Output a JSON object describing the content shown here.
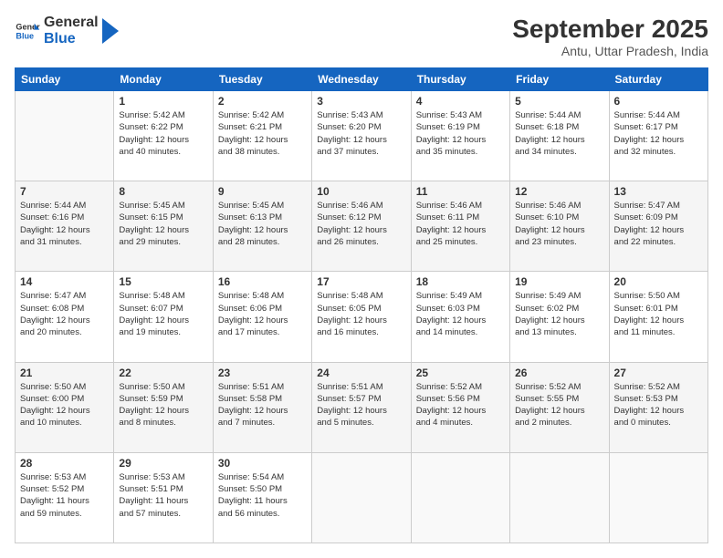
{
  "header": {
    "logo_general": "General",
    "logo_blue": "Blue",
    "month_title": "September 2025",
    "subtitle": "Antu, Uttar Pradesh, India"
  },
  "days_of_week": [
    "Sunday",
    "Monday",
    "Tuesday",
    "Wednesday",
    "Thursday",
    "Friday",
    "Saturday"
  ],
  "weeks": [
    [
      {
        "day": "",
        "info": ""
      },
      {
        "day": "1",
        "info": "Sunrise: 5:42 AM\nSunset: 6:22 PM\nDaylight: 12 hours\nand 40 minutes."
      },
      {
        "day": "2",
        "info": "Sunrise: 5:42 AM\nSunset: 6:21 PM\nDaylight: 12 hours\nand 38 minutes."
      },
      {
        "day": "3",
        "info": "Sunrise: 5:43 AM\nSunset: 6:20 PM\nDaylight: 12 hours\nand 37 minutes."
      },
      {
        "day": "4",
        "info": "Sunrise: 5:43 AM\nSunset: 6:19 PM\nDaylight: 12 hours\nand 35 minutes."
      },
      {
        "day": "5",
        "info": "Sunrise: 5:44 AM\nSunset: 6:18 PM\nDaylight: 12 hours\nand 34 minutes."
      },
      {
        "day": "6",
        "info": "Sunrise: 5:44 AM\nSunset: 6:17 PM\nDaylight: 12 hours\nand 32 minutes."
      }
    ],
    [
      {
        "day": "7",
        "info": "Sunrise: 5:44 AM\nSunset: 6:16 PM\nDaylight: 12 hours\nand 31 minutes."
      },
      {
        "day": "8",
        "info": "Sunrise: 5:45 AM\nSunset: 6:15 PM\nDaylight: 12 hours\nand 29 minutes."
      },
      {
        "day": "9",
        "info": "Sunrise: 5:45 AM\nSunset: 6:13 PM\nDaylight: 12 hours\nand 28 minutes."
      },
      {
        "day": "10",
        "info": "Sunrise: 5:46 AM\nSunset: 6:12 PM\nDaylight: 12 hours\nand 26 minutes."
      },
      {
        "day": "11",
        "info": "Sunrise: 5:46 AM\nSunset: 6:11 PM\nDaylight: 12 hours\nand 25 minutes."
      },
      {
        "day": "12",
        "info": "Sunrise: 5:46 AM\nSunset: 6:10 PM\nDaylight: 12 hours\nand 23 minutes."
      },
      {
        "day": "13",
        "info": "Sunrise: 5:47 AM\nSunset: 6:09 PM\nDaylight: 12 hours\nand 22 minutes."
      }
    ],
    [
      {
        "day": "14",
        "info": "Sunrise: 5:47 AM\nSunset: 6:08 PM\nDaylight: 12 hours\nand 20 minutes."
      },
      {
        "day": "15",
        "info": "Sunrise: 5:48 AM\nSunset: 6:07 PM\nDaylight: 12 hours\nand 19 minutes."
      },
      {
        "day": "16",
        "info": "Sunrise: 5:48 AM\nSunset: 6:06 PM\nDaylight: 12 hours\nand 17 minutes."
      },
      {
        "day": "17",
        "info": "Sunrise: 5:48 AM\nSunset: 6:05 PM\nDaylight: 12 hours\nand 16 minutes."
      },
      {
        "day": "18",
        "info": "Sunrise: 5:49 AM\nSunset: 6:03 PM\nDaylight: 12 hours\nand 14 minutes."
      },
      {
        "day": "19",
        "info": "Sunrise: 5:49 AM\nSunset: 6:02 PM\nDaylight: 12 hours\nand 13 minutes."
      },
      {
        "day": "20",
        "info": "Sunrise: 5:50 AM\nSunset: 6:01 PM\nDaylight: 12 hours\nand 11 minutes."
      }
    ],
    [
      {
        "day": "21",
        "info": "Sunrise: 5:50 AM\nSunset: 6:00 PM\nDaylight: 12 hours\nand 10 minutes."
      },
      {
        "day": "22",
        "info": "Sunrise: 5:50 AM\nSunset: 5:59 PM\nDaylight: 12 hours\nand 8 minutes."
      },
      {
        "day": "23",
        "info": "Sunrise: 5:51 AM\nSunset: 5:58 PM\nDaylight: 12 hours\nand 7 minutes."
      },
      {
        "day": "24",
        "info": "Sunrise: 5:51 AM\nSunset: 5:57 PM\nDaylight: 12 hours\nand 5 minutes."
      },
      {
        "day": "25",
        "info": "Sunrise: 5:52 AM\nSunset: 5:56 PM\nDaylight: 12 hours\nand 4 minutes."
      },
      {
        "day": "26",
        "info": "Sunrise: 5:52 AM\nSunset: 5:55 PM\nDaylight: 12 hours\nand 2 minutes."
      },
      {
        "day": "27",
        "info": "Sunrise: 5:52 AM\nSunset: 5:53 PM\nDaylight: 12 hours\nand 0 minutes."
      }
    ],
    [
      {
        "day": "28",
        "info": "Sunrise: 5:53 AM\nSunset: 5:52 PM\nDaylight: 11 hours\nand 59 minutes."
      },
      {
        "day": "29",
        "info": "Sunrise: 5:53 AM\nSunset: 5:51 PM\nDaylight: 11 hours\nand 57 minutes."
      },
      {
        "day": "30",
        "info": "Sunrise: 5:54 AM\nSunset: 5:50 PM\nDaylight: 11 hours\nand 56 minutes."
      },
      {
        "day": "",
        "info": ""
      },
      {
        "day": "",
        "info": ""
      },
      {
        "day": "",
        "info": ""
      },
      {
        "day": "",
        "info": ""
      }
    ]
  ]
}
